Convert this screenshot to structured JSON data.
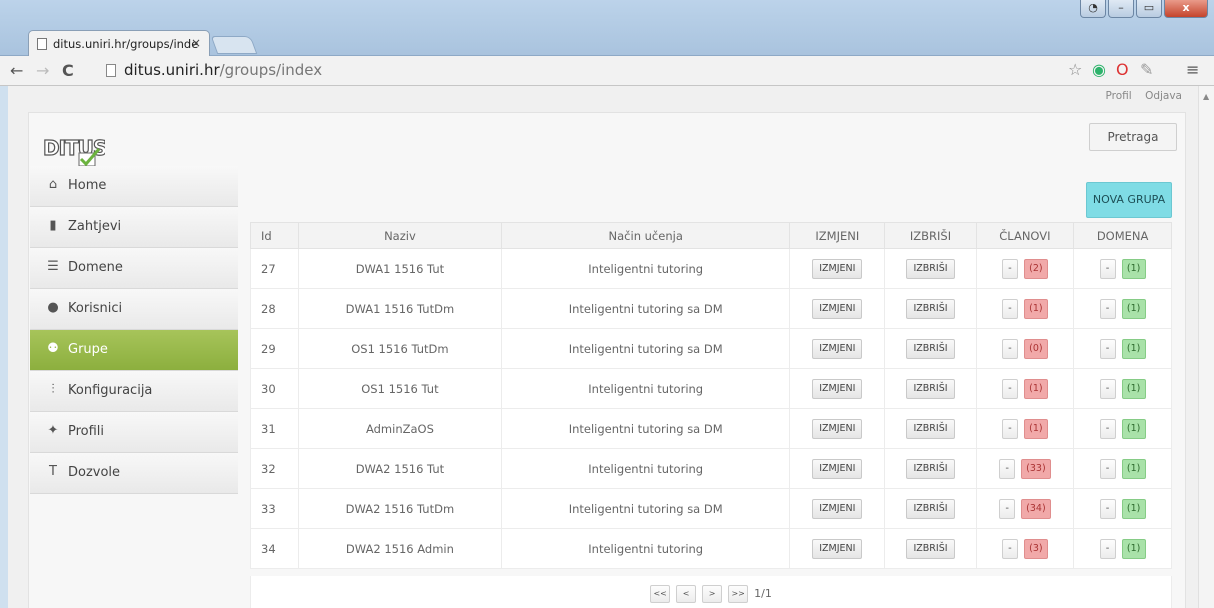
{
  "browser": {
    "tab_title": "ditus.uniri.hr/groups/inde",
    "tab_close": "×",
    "url_host": "ditus.uniri.hr",
    "url_path": "/groups/index"
  },
  "header": {
    "profile_link": "Profil",
    "logout_link": "Odjava",
    "search_button": "Pretraga"
  },
  "sidebar": {
    "items": [
      {
        "label": "Home",
        "icon": "home-icon",
        "glyph": "⌂"
      },
      {
        "label": "Zahtjevi",
        "icon": "clipboard-icon",
        "glyph": "▮"
      },
      {
        "label": "Domene",
        "icon": "database-icon",
        "glyph": "☰"
      },
      {
        "label": "Korisnici",
        "icon": "user-icon",
        "glyph": "●"
      },
      {
        "label": "Grupe",
        "icon": "users-icon",
        "glyph": "⚉"
      },
      {
        "label": "Konfiguracija",
        "icon": "sliders-icon",
        "glyph": "⫶"
      },
      {
        "label": "Profili",
        "icon": "walking-person-icon",
        "glyph": "✦"
      },
      {
        "label": "Dozvole",
        "icon": "key-icon",
        "glyph": "T"
      }
    ],
    "active_index": 4
  },
  "content": {
    "new_group_button": "NOVA GRUPA",
    "columns": [
      "Id",
      "Naziv",
      "Način učenja",
      "IZMJENI",
      "IZBRIŠI",
      "ČLANOVI",
      "DOMENA"
    ],
    "edit_label": "IZMJENI",
    "delete_label": "IZBRIŠI",
    "minus_label": "-",
    "rows": [
      {
        "id": "27",
        "naziv": "DWA1 1516 Tut",
        "nacin": "Inteligentni tutoring",
        "clanovi": "(2)",
        "domena": "(1)"
      },
      {
        "id": "28",
        "naziv": "DWA1 1516 TutDm",
        "nacin": "Inteligentni tutoring sa DM",
        "clanovi": "(1)",
        "domena": "(1)"
      },
      {
        "id": "29",
        "naziv": "OS1 1516 TutDm",
        "nacin": "Inteligentni tutoring sa DM",
        "clanovi": "(0)",
        "domena": "(1)"
      },
      {
        "id": "30",
        "naziv": "OS1 1516 Tut",
        "nacin": "Inteligentni tutoring",
        "clanovi": "(1)",
        "domena": "(1)"
      },
      {
        "id": "31",
        "naziv": "AdminZaOS",
        "nacin": "Inteligentni tutoring sa DM",
        "clanovi": "(1)",
        "domena": "(1)"
      },
      {
        "id": "32",
        "naziv": "DWA2 1516 Tut",
        "nacin": "Inteligentni tutoring",
        "clanovi": "(33)",
        "domena": "(1)"
      },
      {
        "id": "33",
        "naziv": "DWA2 1516 TutDm",
        "nacin": "Inteligentni tutoring sa DM",
        "clanovi": "(34)",
        "domena": "(1)"
      },
      {
        "id": "34",
        "naziv": "DWA2 1516 Admin",
        "nacin": "Inteligentni tutoring",
        "clanovi": "(3)",
        "domena": "(1)"
      }
    ],
    "pager": {
      "first": "<<",
      "prev": "<",
      "next": ">",
      "last": ">>",
      "page_text": "1/1"
    }
  },
  "colors": {
    "active_nav": "#9bbb4c",
    "new_group": "#7fdce5",
    "members_badge": "#f1a9a9",
    "domain_badge": "#a9e2a9"
  }
}
